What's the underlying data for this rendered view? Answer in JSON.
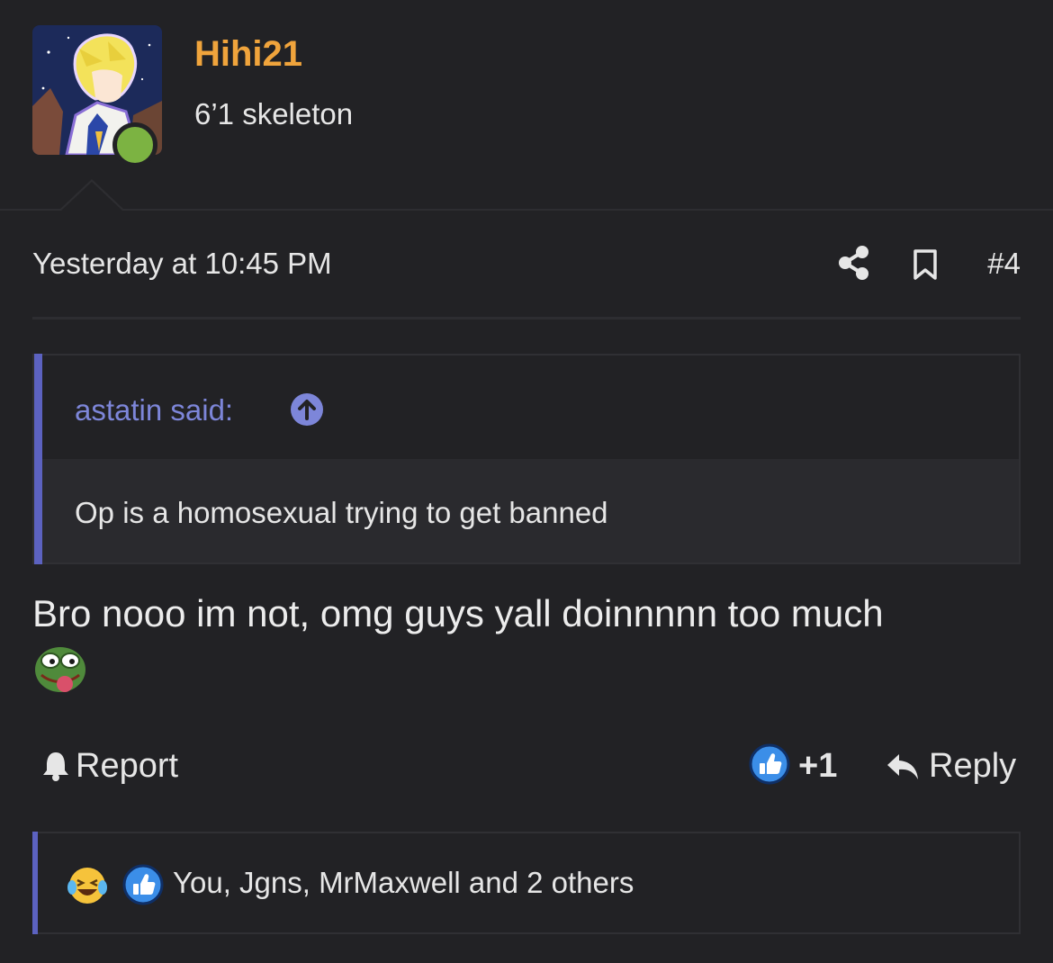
{
  "author": {
    "username": "Hihi21",
    "user_title": "6’1 skeleton",
    "online": true
  },
  "post": {
    "date": "Yesterday at 10:45 PM",
    "number": "#4",
    "share_icon": "share-icon",
    "bookmark_icon": "bookmark-icon"
  },
  "quote": {
    "attribution": "astatin said:",
    "jump_icon": "arrow-up-circle-icon",
    "text": "Op is a homosexual trying to get banned"
  },
  "message": {
    "text": "Bro nooo im not, omg guys yall doinnnnn too much",
    "emoji": "pepe-emoji"
  },
  "actions": {
    "report_label": "Report",
    "like_count": "+1",
    "reply_label": "Reply"
  },
  "reactions": {
    "icons": [
      "laugh-cry-icon",
      "thumbs-up-icon"
    ],
    "summary": "You, Jgns, MrMaxwell and 2 others"
  },
  "colors": {
    "background": "#222225",
    "username": "#f0a43c",
    "quote_accent": "#5c62c0",
    "quote_link": "#7d86d9",
    "online": "#7cb342",
    "like": "#3b8ee8"
  }
}
